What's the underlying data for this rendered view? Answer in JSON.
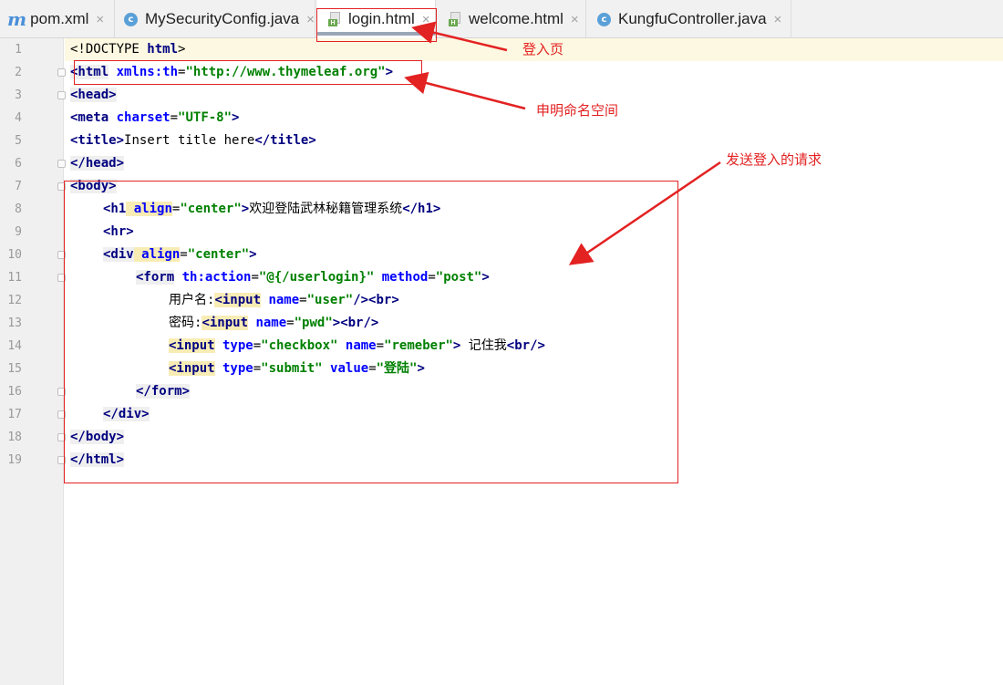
{
  "tabs": [
    {
      "label": "pom.xml",
      "icon": "maven-m-icon"
    },
    {
      "label": "MySecurityConfig.java",
      "icon": "java-class-icon"
    },
    {
      "label": "login.html",
      "icon": "html-file-icon",
      "active": true
    },
    {
      "label": "welcome.html",
      "icon": "html-file-icon"
    },
    {
      "label": "KungfuController.java",
      "icon": "java-class-icon"
    }
  ],
  "icons": {
    "class_letter": "c",
    "html_letter": "H",
    "maven_letter": "m",
    "close": "×"
  },
  "line_numbers": [
    "1",
    "2",
    "3",
    "4",
    "5",
    "6",
    "7",
    "8",
    "9",
    "10",
    "11",
    "12",
    "13",
    "14",
    "15",
    "16",
    "17",
    "18",
    "19"
  ],
  "code": {
    "l1": {
      "doctype": "<!DOCTYPE ",
      "html": "html",
      "close": ">"
    },
    "l2": {
      "open": "<html",
      "attr": " xmlns:th",
      "eq": "=",
      "val": "\"http://www.thymeleaf.org\"",
      "close": ">"
    },
    "l3": "<head>",
    "l4": {
      "open": "<meta",
      "attr": " charset",
      "eq": "=",
      "val": "\"UTF-8\"",
      "close": ">"
    },
    "l5": {
      "open": "<title>",
      "text": "Insert title here",
      "close": "</title>"
    },
    "l6": "</head>",
    "l7": "<body>",
    "l8": {
      "open": "<h1",
      "attr": " align",
      "eq": "=",
      "val": "\"center\"",
      "gt": ">",
      "text": "欢迎登陆武林秘籍管理系统",
      "close": "</h1>"
    },
    "l9": "<hr>",
    "l10": {
      "open": "<div",
      "attr": " align",
      "eq": "=",
      "val": "\"center\"",
      "close": ">"
    },
    "l11": {
      "open": "<form",
      "attr1": " th:action",
      "eq1": "=",
      "val1": "\"@{/userlogin}\"",
      "attr2": " method",
      "eq2": "=",
      "val2": "\"post\"",
      "close": ">"
    },
    "l12": {
      "text": "用户名:",
      "open": "<input",
      "attr": " name",
      "eq": "=",
      "val": "\"user\"",
      "close": "/>",
      "br": "<br>"
    },
    "l13": {
      "text": "密码:",
      "open": "<input",
      "attr": " name",
      "eq": "=",
      "val": "\"pwd\"",
      "close": ">",
      "br": "<br/>"
    },
    "l14": {
      "open": "<input",
      "attr1": " type",
      "eq1": "=",
      "val1": "\"checkbox\"",
      "attr2": " name",
      "eq2": "=",
      "val2": "\"remeber\"",
      "close": ">",
      "text": " 记住我",
      "br": "<br/>"
    },
    "l15": {
      "open": "<input",
      "attr1": " type",
      "eq1": "=",
      "val1": "\"submit\"",
      "attr2": " value",
      "eq2": "=",
      "val2": "\"登陆\"",
      "close": ">"
    },
    "l16": "</form>",
    "l17": "</div>",
    "l18": "</body>",
    "l19": "</html>"
  },
  "annotations": {
    "login_page": "登入页",
    "namespace": "申明命名空间",
    "login_request": "发送登入的请求"
  },
  "colors": {
    "annotation": "#e32222",
    "tag": "#000080",
    "attr": "#0000ff",
    "string": "#008000"
  }
}
